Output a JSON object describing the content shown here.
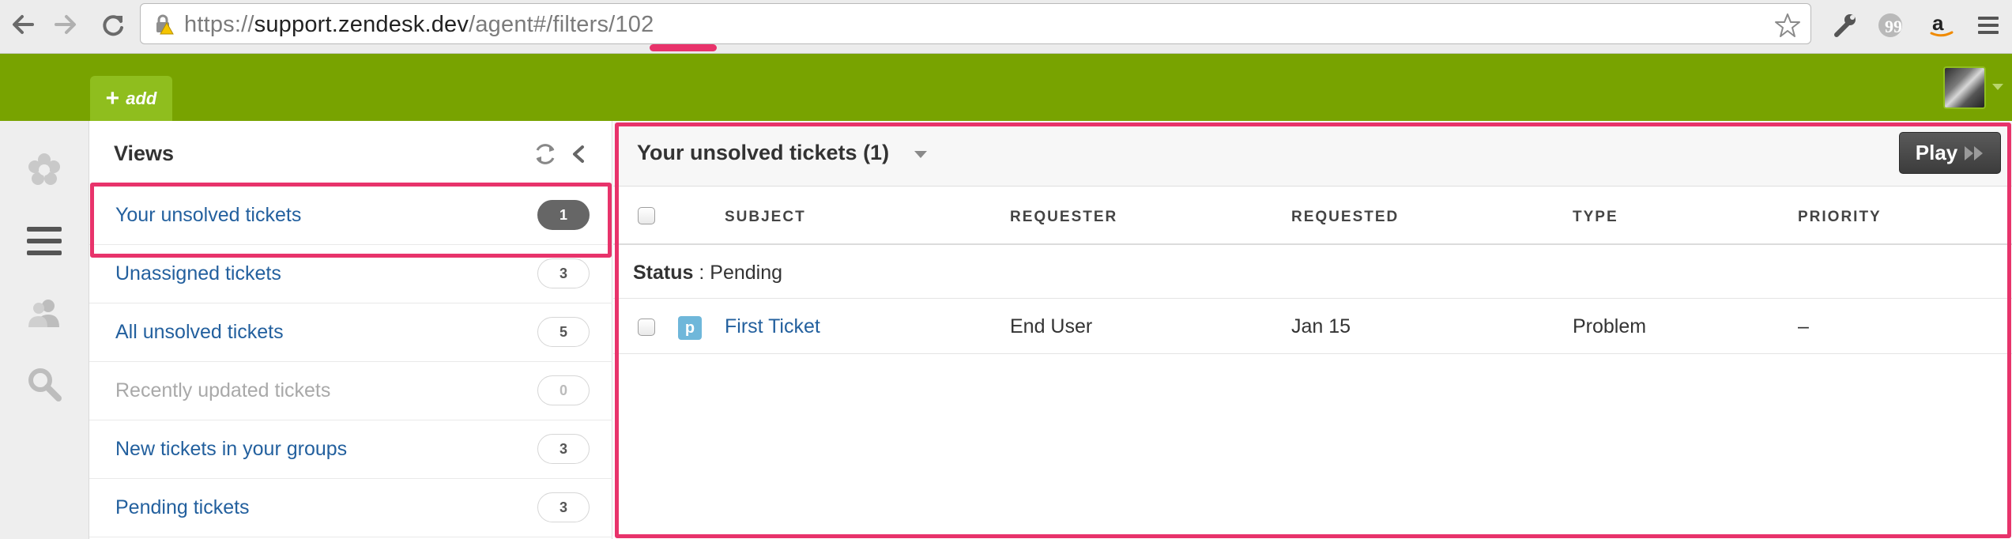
{
  "browser": {
    "url_prefix": "https://",
    "url_host": "support.zendesk.dev",
    "url_path": "/agent#/filters/102"
  },
  "appbar": {
    "add_symbol": "+",
    "add_label": "add"
  },
  "views_panel": {
    "title": "Views",
    "items": [
      {
        "label": "Your unsolved tickets",
        "count": "1"
      },
      {
        "label": "Unassigned tickets",
        "count": "3"
      },
      {
        "label": "All unsolved tickets",
        "count": "5"
      },
      {
        "label": "Recently updated tickets",
        "count": "0"
      },
      {
        "label": "New tickets in your groups",
        "count": "3"
      },
      {
        "label": "Pending tickets",
        "count": "3"
      }
    ]
  },
  "main": {
    "title": "Your unsolved tickets (1)",
    "play_label": "Play",
    "columns": {
      "subject": "SUBJECT",
      "requester": "REQUESTER",
      "requested": "REQUESTED",
      "type": "TYPE",
      "priority": "PRIORITY"
    },
    "group": {
      "key": "Status",
      "separator": ":",
      "value": "Pending"
    },
    "tickets": [
      {
        "status_letter": "p",
        "subject": "First Ticket",
        "requester": "End User",
        "requested": "Jan 15",
        "type": "Problem",
        "priority": "–"
      }
    ]
  },
  "colors": {
    "appbar_green": "#78a300",
    "highlight": "#e8336b",
    "link_blue": "#23609e",
    "pending_badge": "#6fb7da"
  }
}
